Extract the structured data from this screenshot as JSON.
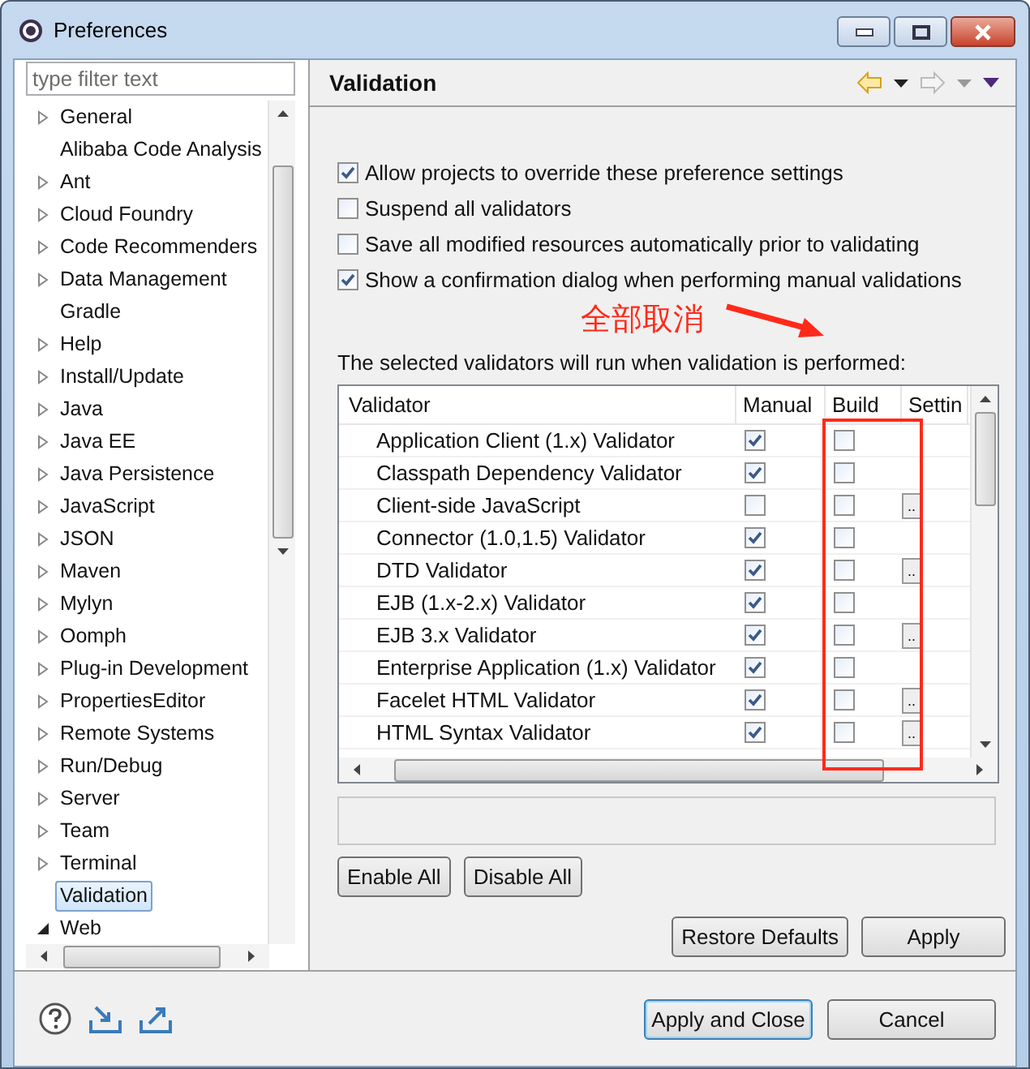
{
  "window": {
    "title": "Preferences"
  },
  "filter": {
    "placeholder": "type filter text"
  },
  "tree": [
    {
      "label": "General",
      "expanded": false,
      "selected": false
    },
    {
      "label": "Alibaba Code Analysis",
      "selected": false
    },
    {
      "label": "Ant",
      "expanded": false,
      "selected": false
    },
    {
      "label": "Cloud Foundry",
      "expanded": false,
      "selected": false
    },
    {
      "label": "Code Recommenders",
      "expanded": false,
      "selected": false
    },
    {
      "label": "Data Management",
      "expanded": false,
      "selected": false
    },
    {
      "label": "Gradle",
      "selected": false
    },
    {
      "label": "Help",
      "expanded": false,
      "selected": false
    },
    {
      "label": "Install/Update",
      "expanded": false,
      "selected": false
    },
    {
      "label": "Java",
      "expanded": false,
      "selected": false
    },
    {
      "label": "Java EE",
      "expanded": false,
      "selected": false
    },
    {
      "label": "Java Persistence",
      "expanded": false,
      "selected": false
    },
    {
      "label": "JavaScript",
      "expanded": false,
      "selected": false
    },
    {
      "label": "JSON",
      "expanded": false,
      "selected": false
    },
    {
      "label": "Maven",
      "expanded": false,
      "selected": false
    },
    {
      "label": "Mylyn",
      "expanded": false,
      "selected": false
    },
    {
      "label": "Oomph",
      "expanded": false,
      "selected": false
    },
    {
      "label": "Plug-in Development",
      "expanded": false,
      "selected": false
    },
    {
      "label": "PropertiesEditor",
      "expanded": false,
      "selected": false
    },
    {
      "label": "Remote Systems",
      "expanded": false,
      "selected": false
    },
    {
      "label": "Run/Debug",
      "expanded": false,
      "selected": false
    },
    {
      "label": "Server",
      "expanded": false,
      "selected": false
    },
    {
      "label": "Team",
      "expanded": false,
      "selected": false
    },
    {
      "label": "Terminal",
      "expanded": false,
      "selected": false
    },
    {
      "label": "Validation",
      "selected": true
    },
    {
      "label": "Web",
      "expanded": true,
      "selected": false
    }
  ],
  "page": {
    "title": "Validation",
    "options": [
      {
        "label": "Allow projects to override these preference settings",
        "checked": true
      },
      {
        "label": "Suspend all validators",
        "checked": false
      },
      {
        "label": "Save all modified resources automatically prior to validating",
        "checked": false
      },
      {
        "label": "Show a confirmation dialog when performing manual validations",
        "checked": true
      }
    ],
    "table_label": "The selected validators will run when validation is performed:",
    "table": {
      "columns": [
        "Validator",
        "Manual",
        "Build",
        "Settin"
      ],
      "rows": [
        {
          "name": "Application Client (1.x) Validator",
          "manual": true,
          "build": false
        },
        {
          "name": "Classpath Dependency Validator",
          "manual": true,
          "build": false
        },
        {
          "name": "Client-side JavaScript",
          "manual": false,
          "build": false,
          "settings": ".."
        },
        {
          "name": "Connector (1.0,1.5) Validator",
          "manual": true,
          "build": false
        },
        {
          "name": "DTD Validator",
          "manual": true,
          "build": false,
          "settings": ".."
        },
        {
          "name": "EJB (1.x-2.x) Validator",
          "manual": true,
          "build": false
        },
        {
          "name": "EJB 3.x Validator",
          "manual": true,
          "build": false,
          "settings": ".."
        },
        {
          "name": "Enterprise Application (1.x) Validator",
          "manual": true,
          "build": false
        },
        {
          "name": "Facelet HTML Validator",
          "manual": true,
          "build": false,
          "settings": ".."
        },
        {
          "name": "HTML Syntax Validator",
          "manual": true,
          "build": false,
          "settings": ".."
        }
      ]
    },
    "table_buttons": [
      "Enable All",
      "Disable All"
    ],
    "page_buttons": [
      "Restore Defaults",
      "Apply"
    ]
  },
  "annotation": {
    "text": "全部取消"
  },
  "dialog_buttons": [
    {
      "label": "Apply and Close",
      "default": true
    },
    {
      "label": "Cancel",
      "default": false
    }
  ]
}
